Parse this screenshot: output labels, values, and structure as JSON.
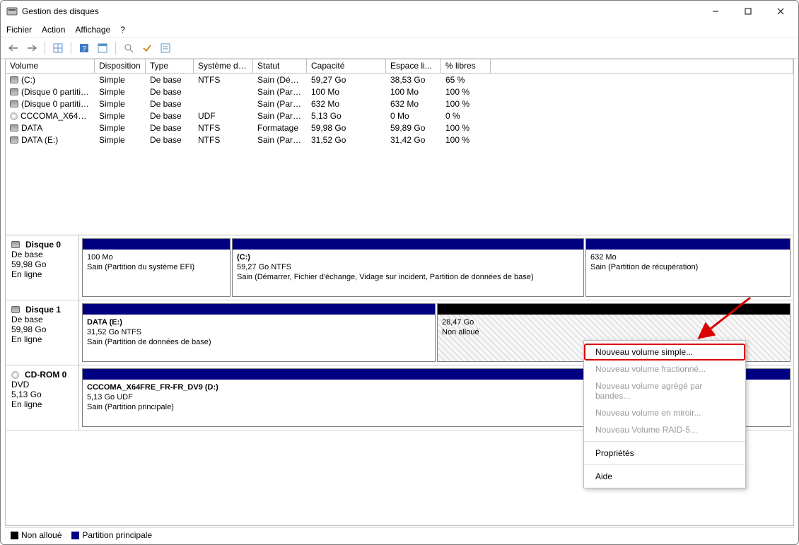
{
  "window": {
    "title": "Gestion des disques"
  },
  "menu": {
    "file": "Fichier",
    "action": "Action",
    "view": "Affichage",
    "help": "?"
  },
  "columns": [
    "Volume",
    "Disposition",
    "Type",
    "Système de ...",
    "Statut",
    "Capacité",
    "Espace li...",
    "% libres"
  ],
  "volumes": [
    {
      "name": "(C:)",
      "icon": "disk",
      "layout": "Simple",
      "type": "De base",
      "fs": "NTFS",
      "status": "Sain (Dém...",
      "capacity": "59,27 Go",
      "free": "38,53 Go",
      "pct": "65 %"
    },
    {
      "name": "(Disque 0 partition...",
      "icon": "disk",
      "layout": "Simple",
      "type": "De base",
      "fs": "",
      "status": "Sain (Parti...",
      "capacity": "100 Mo",
      "free": "100 Mo",
      "pct": "100 %"
    },
    {
      "name": "(Disque 0 partition...",
      "icon": "disk",
      "layout": "Simple",
      "type": "De base",
      "fs": "",
      "status": "Sain (Parti...",
      "capacity": "632 Mo",
      "free": "632 Mo",
      "pct": "100 %"
    },
    {
      "name": "CCCOMA_X64FRE...",
      "icon": "cd",
      "layout": "Simple",
      "type": "De base",
      "fs": "UDF",
      "status": "Sain (Parti...",
      "capacity": "5,13 Go",
      "free": "0 Mo",
      "pct": "0 %"
    },
    {
      "name": "DATA",
      "icon": "disk",
      "layout": "Simple",
      "type": "De base",
      "fs": "NTFS",
      "status": "Formatage",
      "capacity": "59,98 Go",
      "free": "59,89 Go",
      "pct": "100 %"
    },
    {
      "name": "DATA (E:)",
      "icon": "disk",
      "layout": "Simple",
      "type": "De base",
      "fs": "NTFS",
      "status": "Sain (Parti...",
      "capacity": "31,52 Go",
      "free": "31,42 Go",
      "pct": "100 %"
    }
  ],
  "disk0": {
    "name": "Disque 0",
    "type": "De base",
    "size": "59,98 Go",
    "status": "En ligne",
    "p1": {
      "line1": "",
      "line2": "100 Mo",
      "line3": "Sain (Partition du système EFI)"
    },
    "p2": {
      "line1": "(C:)",
      "line2": "59,27 Go NTFS",
      "line3": "Sain (Démarrer, Fichier d'échange, Vidage sur incident, Partition de données de base)"
    },
    "p3": {
      "line1": "",
      "line2": "632 Mo",
      "line3": "Sain (Partition de récupération)"
    }
  },
  "disk1": {
    "name": "Disque 1",
    "type": "De base",
    "size": "59,98 Go",
    "status": "En ligne",
    "p1": {
      "line1": "DATA  (E:)",
      "line2": "31,52 Go NTFS",
      "line3": "Sain (Partition de données de base)"
    },
    "p2": {
      "line1": "",
      "line2": "28,47 Go",
      "line3": "Non alloué"
    }
  },
  "cdrom": {
    "name": "CD-ROM 0",
    "type": "DVD",
    "size": "5,13 Go",
    "status": "En ligne",
    "p1": {
      "line1": "CCCOMA_X64FRE_FR-FR_DV9  (D:)",
      "line2": "5,13 Go UDF",
      "line3": "Sain (Partition principale)"
    }
  },
  "legend": {
    "unalloc": "Non alloué",
    "primary": "Partition principale"
  },
  "ctx": {
    "simple": "Nouveau volume simple...",
    "spanned": "Nouveau volume fractionné...",
    "striped": "Nouveau volume agrégé par bandes...",
    "mirror": "Nouveau volume en miroir...",
    "raid5": "Nouveau Volume RAID-5...",
    "props": "Propriétés",
    "help": "Aide"
  }
}
